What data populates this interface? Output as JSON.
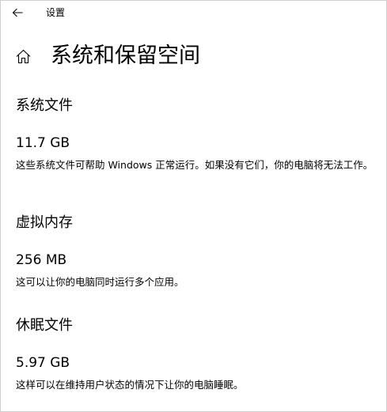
{
  "titlebar": {
    "app_title": "设置",
    "back_icon": "back-arrow-icon"
  },
  "header": {
    "home_icon": "home-icon",
    "title": "系统和保留空间"
  },
  "sections": [
    {
      "heading": "系统文件",
      "value": "11.7 GB",
      "description": "这些系统文件可帮助 Windows 正常运行。如果没有它们，你的电脑将无法工作。"
    },
    {
      "heading": "虚拟内存",
      "value": "256 MB",
      "description": "这可以让你的电脑同时运行多个应用。"
    },
    {
      "heading": "休眠文件",
      "value": "5.97 GB",
      "description": "这样可以在维持用户状态的情况下让你的电脑睡眠。"
    }
  ],
  "colors": {
    "background": "#ffffff",
    "text": "#000000",
    "border": "#cfcfcf"
  }
}
